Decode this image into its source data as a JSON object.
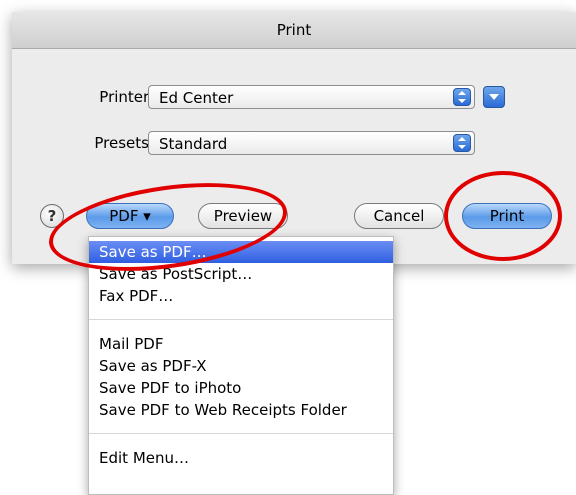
{
  "dialog": {
    "title": "Print",
    "printer_label": "Printer:",
    "printer_value": "Ed Center",
    "presets_label": "Presets:",
    "presets_value": "Standard"
  },
  "buttons": {
    "help": "?",
    "pdf": "PDF ▾",
    "preview": "Preview",
    "cancel": "Cancel",
    "print": "Print"
  },
  "pdf_menu": {
    "groups": [
      [
        "Save as PDF…",
        "Save as PostScript…",
        "Fax PDF…"
      ],
      [
        "Mail PDF",
        "Save as PDF-X",
        "Save PDF to iPhoto",
        "Save PDF to Web Receipts Folder"
      ],
      [
        "Edit Menu…"
      ]
    ],
    "selected": "Save as PDF…"
  },
  "colors": {
    "highlight_circle": "#e00000",
    "selection": "#2f5fe0",
    "accent_button": "#5b9be9"
  }
}
